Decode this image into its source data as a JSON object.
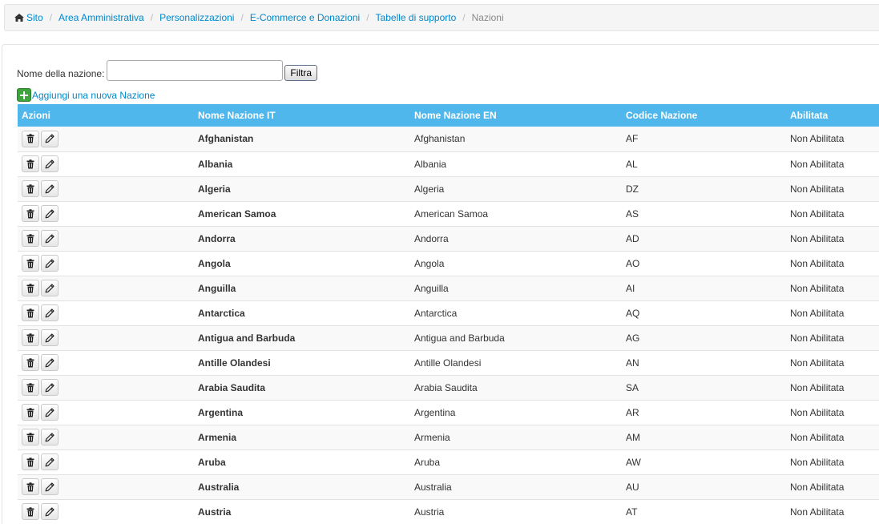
{
  "breadcrumb": {
    "items": [
      "Sito",
      "Area Amministrativa",
      "Personalizzazioni",
      "E-Commerce e Donazioni",
      "Tabelle di supporto"
    ],
    "current": "Nazioni"
  },
  "filter": {
    "label": "Nome della nazione:",
    "value": "",
    "placeholder": "",
    "button_label": "Filtra"
  },
  "add_link": {
    "label": "Aggiungi una nuova Nazione"
  },
  "table": {
    "columns": [
      "Azioni",
      "Nome Nazione IT",
      "Nome Nazione EN",
      "Codice Nazione",
      "Abilitata"
    ],
    "rows": [
      {
        "it": "Afghanistan",
        "en": "Afghanistan",
        "code": "AF",
        "enabled": "Non Abilitata"
      },
      {
        "it": "Albania",
        "en": "Albania",
        "code": "AL",
        "enabled": "Non Abilitata"
      },
      {
        "it": "Algeria",
        "en": "Algeria",
        "code": "DZ",
        "enabled": "Non Abilitata"
      },
      {
        "it": "American Samoa",
        "en": "American Samoa",
        "code": "AS",
        "enabled": "Non Abilitata"
      },
      {
        "it": "Andorra",
        "en": "Andorra",
        "code": "AD",
        "enabled": "Non Abilitata"
      },
      {
        "it": "Angola",
        "en": "Angola",
        "code": "AO",
        "enabled": "Non Abilitata"
      },
      {
        "it": "Anguilla",
        "en": "Anguilla",
        "code": "AI",
        "enabled": "Non Abilitata"
      },
      {
        "it": "Antarctica",
        "en": "Antarctica",
        "code": "AQ",
        "enabled": "Non Abilitata"
      },
      {
        "it": "Antigua and Barbuda",
        "en": "Antigua and Barbuda",
        "code": "AG",
        "enabled": "Non Abilitata"
      },
      {
        "it": "Antille Olandesi",
        "en": "Antille Olandesi",
        "code": "AN",
        "enabled": "Non Abilitata"
      },
      {
        "it": "Arabia Saudita",
        "en": "Arabia Saudita",
        "code": "SA",
        "enabled": "Non Abilitata"
      },
      {
        "it": "Argentina",
        "en": "Argentina",
        "code": "AR",
        "enabled": "Non Abilitata"
      },
      {
        "it": "Armenia",
        "en": "Armenia",
        "code": "AM",
        "enabled": "Non Abilitata"
      },
      {
        "it": "Aruba",
        "en": "Aruba",
        "code": "AW",
        "enabled": "Non Abilitata"
      },
      {
        "it": "Australia",
        "en": "Australia",
        "code": "AU",
        "enabled": "Non Abilitata"
      },
      {
        "it": "Austria",
        "en": "Austria",
        "code": "AT",
        "enabled": "Non Abilitata"
      }
    ]
  },
  "icons": {
    "home": "home-icon",
    "add": "plus-icon",
    "delete": "trash-icon",
    "edit": "pencil-icon"
  },
  "colors": {
    "header_bg": "#50b7ec",
    "link": "#0088cc",
    "add_icon": "#3ea43e"
  }
}
